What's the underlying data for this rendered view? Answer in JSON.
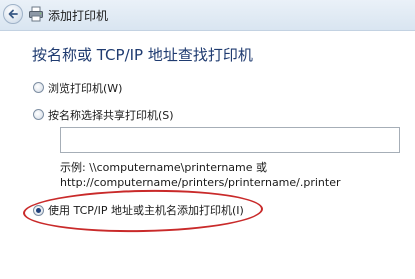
{
  "window": {
    "title": "添加打印机",
    "icons": {
      "back": "back-arrow-icon",
      "printer": "printer-icon"
    }
  },
  "main": {
    "heading": "按名称或 TCP/IP 地址查找打印机",
    "options": [
      {
        "label": "浏览打印机(W)",
        "checked": false
      },
      {
        "label": "按名称选择共享打印机(S)",
        "checked": false
      },
      {
        "label": "使用 TCP/IP 地址或主机名添加打印机(I)",
        "checked": true
      }
    ],
    "share_input": {
      "value": ""
    },
    "example_line1": "示例: \\\\computername\\printername 或",
    "example_line2": "http://computername/printers/printername/.printer"
  },
  "colors": {
    "heading": "#1f3b70",
    "highlight": "#c92a2a"
  }
}
